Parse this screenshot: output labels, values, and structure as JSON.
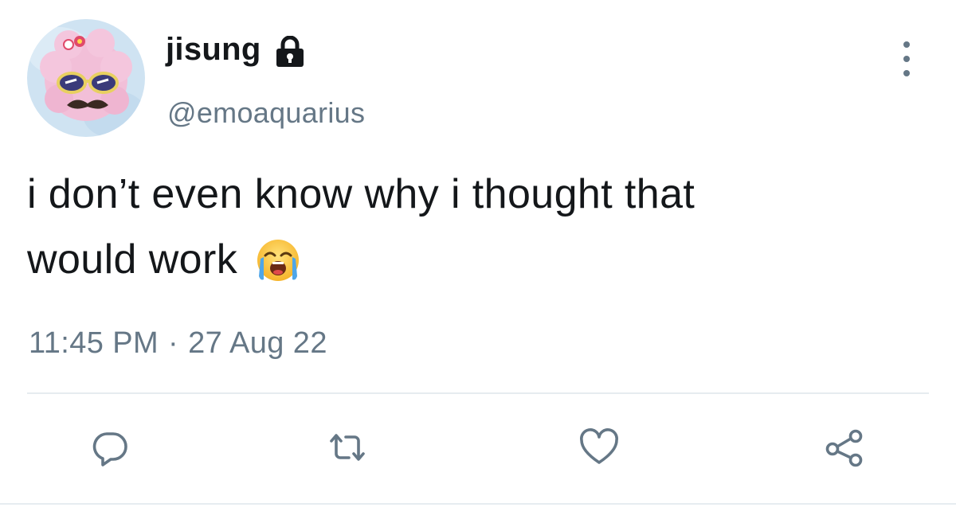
{
  "author": {
    "display_name": "jisung",
    "handle": "@emoaquarius",
    "protected": true,
    "lock_icon": "lock-icon",
    "avatar_icon": "avatar-cartoon-sheep"
  },
  "tweet": {
    "text_line1": "i don’t even know why i thought that",
    "text_line2": "would work",
    "emoji": "loudly-crying-face-emoji"
  },
  "meta": {
    "time": "11:45 PM",
    "separator": "·",
    "date": "27 Aug 22"
  },
  "actions": {
    "reply_icon": "reply-icon",
    "retweet_icon": "retweet-icon",
    "like_icon": "heart-icon",
    "share_icon": "share-icon",
    "more_icon": "more-vertical-icon"
  },
  "colors": {
    "text_primary": "#14171a",
    "text_secondary": "#657786",
    "icon": "#657786",
    "divider": "#e6ecf0"
  }
}
